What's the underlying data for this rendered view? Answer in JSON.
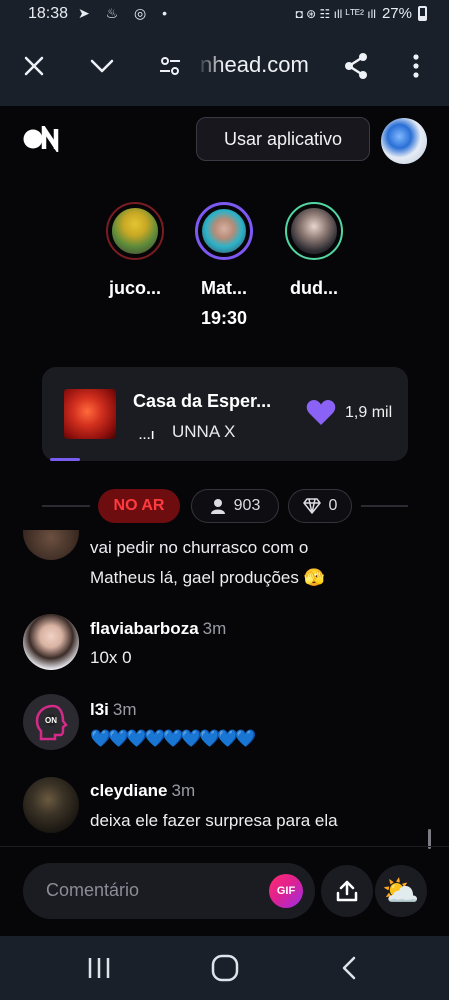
{
  "status_bar": {
    "time": "18:38",
    "left_icons": "➤ ♨ ◎ •",
    "right_icons": "◘ ⊛ ☷ ıll ᴸᵀᴱ² ıll",
    "battery": "27%"
  },
  "browser": {
    "url": "nhead.com",
    "close_icon": "close-icon",
    "chevron_icon": "chevron-down-icon",
    "settings_icon": "site-settings-icon",
    "share_icon": "share-icon",
    "menu_icon": "more-vert-icon"
  },
  "header": {
    "logo_text": "ON",
    "use_app_label": "Usar aplicativo"
  },
  "hosts": [
    {
      "name": "juco...",
      "time": "",
      "ring": "#7a1c22"
    },
    {
      "name": "Mat...",
      "time": "19:30",
      "ring": "#7d59f2"
    },
    {
      "name": "dud...",
      "time": "",
      "ring": "#53d6a2"
    }
  ],
  "song": {
    "title": "Casa da Esper...",
    "artist": "UNNA X",
    "eq_label": "...l",
    "likes": "1,9 mil",
    "progress": 0.08
  },
  "live": {
    "badge": "NO AR",
    "viewers": "903",
    "diamonds": "0"
  },
  "comments": [
    {
      "user": "",
      "time": "",
      "text_lines": [
        "vai pedir no churrasco com o",
        "Matheus lá, gael produções 🫣"
      ]
    },
    {
      "user": "flaviabarboza",
      "time": "3m",
      "text_lines": [
        "10x 0"
      ]
    },
    {
      "user": "l3i",
      "time": "3m",
      "text_lines": [
        "💙💙💙💙💙💙💙💙💙"
      ]
    },
    {
      "user": "cleydiane",
      "time": "3m",
      "text_lines": [
        "deixa ele fazer surpresa para ela"
      ]
    }
  ],
  "footer": {
    "comment_placeholder": "Comentário",
    "gif_label": "GIF",
    "weather_icon": "⛅"
  },
  "colors": {
    "background": "#060609",
    "accent": "#7b5cf0",
    "live_red": "#ff3b3f"
  }
}
